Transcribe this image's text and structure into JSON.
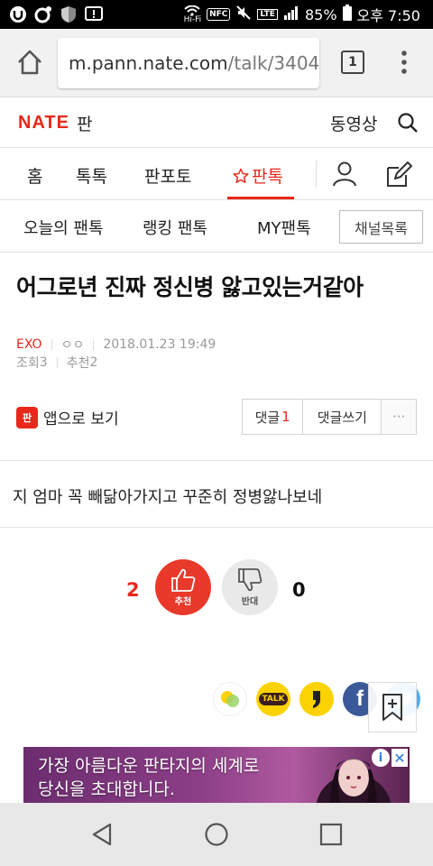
{
  "status_bar": {
    "network_label": "Hi-Fi",
    "nfc_label": "NFC",
    "lte_label": "LTE",
    "battery": "85%",
    "time": "오후 7:50"
  },
  "browser": {
    "url_host": "m.pann.nate.com",
    "url_path": "/talk/3404",
    "tab_count": "1"
  },
  "site_header": {
    "logo_brand": "NATE",
    "logo_section": "판",
    "video_link": "동영상"
  },
  "main_nav": {
    "items": [
      "홈",
      "톡톡",
      "판포토",
      "판톡"
    ]
  },
  "sub_nav": {
    "items": [
      "오늘의 팬톡",
      "랭킹 팬톡",
      "MY팬톡"
    ],
    "channel_button": "채널목록"
  },
  "post": {
    "title": "어그로년 진짜 정신병 앓고있는거같아",
    "board": "EXO",
    "author": "ㅇㅇ",
    "datetime": "2018.01.23 19:49",
    "views_label": "조회",
    "views": "3",
    "recommend_label": "추천",
    "recommend": "2",
    "body": "지 엄마 꼭 빼닮아가지고 꾸준히 정병앓나보네"
  },
  "actions": {
    "app_view": "앱으로 보기",
    "app_icon_text": "판",
    "comments_label": "댓글",
    "comments_count": "1",
    "write_comment": "댓글쓰기",
    "more": "···"
  },
  "votes": {
    "up_count": "2",
    "up_label": "추천",
    "down_count": "0",
    "down_label": "반대"
  },
  "share": {
    "kakaotalk_label": "TALK",
    "facebook_label": "f"
  },
  "ad": {
    "line1": "가장 아름다운 판타지의 세계로",
    "line2": "당신을 초대합니다.",
    "info": "i",
    "close": "✕"
  },
  "colors": {
    "brand_red": "#e8281a",
    "facebook": "#3b5998",
    "kakao_yellow": "#fcd200",
    "twitter": "#55acee"
  }
}
